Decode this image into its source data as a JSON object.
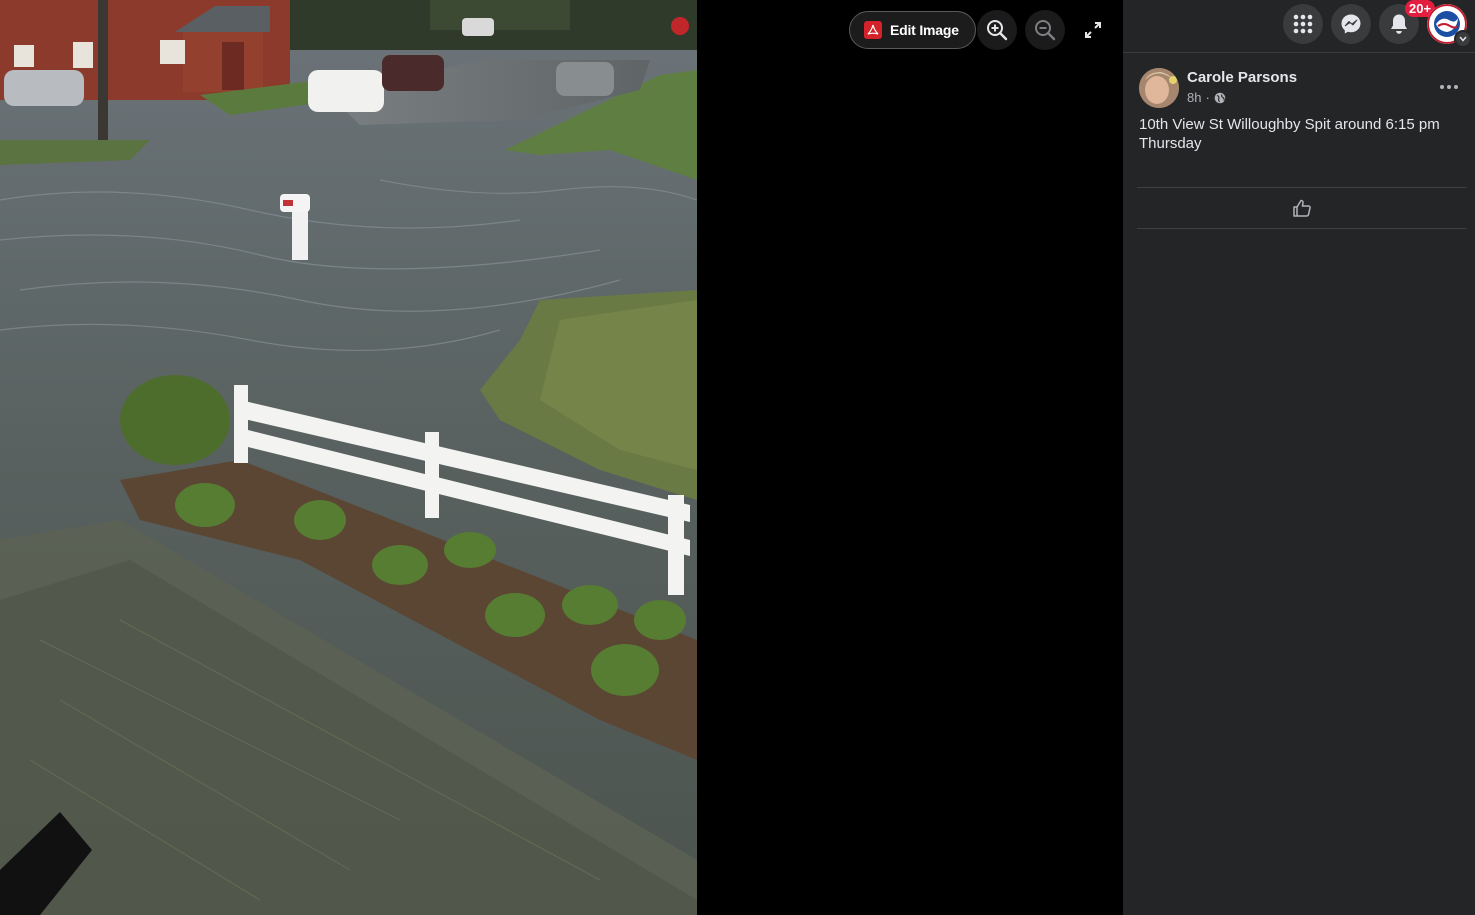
{
  "viewer": {
    "edit_image_label": "Edit Image",
    "icons": {
      "pdf": "acrobat-pdf-icon",
      "zoom_in": "zoom-in-icon",
      "zoom_out": "zoom-out-icon",
      "fullscreen": "fullscreen-icon"
    }
  },
  "topnav": {
    "icons": [
      "menu-grid-icon",
      "messenger-icon",
      "notifications-bell-icon"
    ],
    "notification_badge": "20+"
  },
  "post": {
    "author": "Carole Parsons",
    "time": "8h",
    "separator": "·",
    "audience_icon": "globe-icon",
    "text": "10th View St Willoughby Spit around 6:15 pm Thursday",
    "more_icon": "more-options-icon",
    "like_icon": "thumbs-up-icon"
  },
  "colors": {
    "panel_bg": "#242526",
    "viewer_bg": "#000000",
    "badge_red": "#e41e3f",
    "text_primary": "#e4e6eb",
    "text_secondary": "#b0b3b8"
  }
}
